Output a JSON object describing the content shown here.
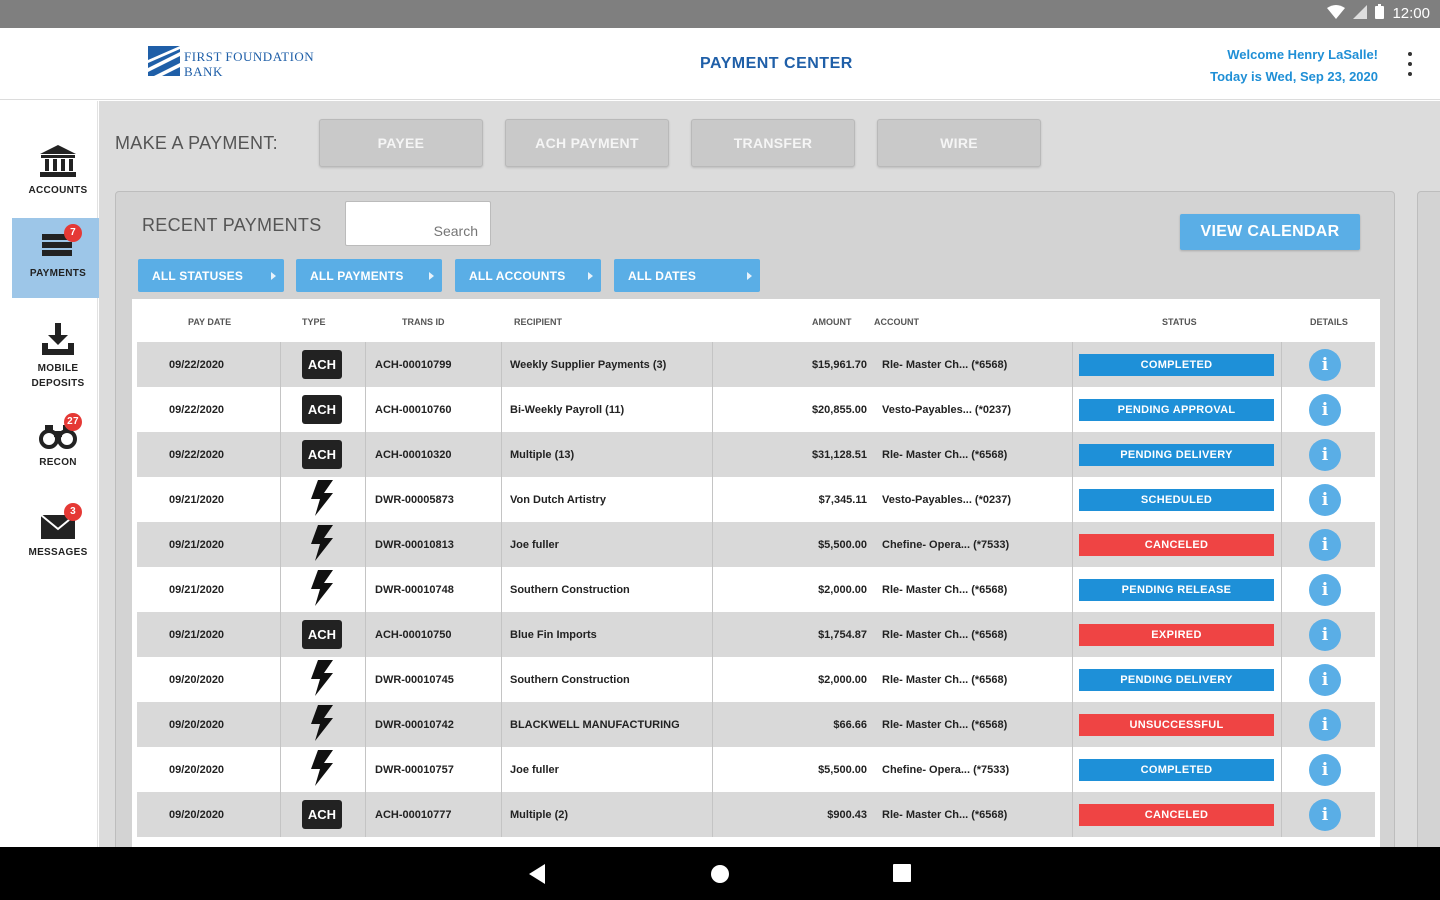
{
  "status_bar": {
    "time": "12:00"
  },
  "header": {
    "logo_line1": "FIRST FOUNDATION",
    "logo_line2": "BANK",
    "title": "PAYMENT CENTER",
    "welcome": "Welcome Henry LaSalle!",
    "date": "Today is Wed, Sep 23, 2020"
  },
  "sidebar": {
    "items": [
      {
        "label": "ACCOUNTS",
        "icon": "bank-icon",
        "badge": ""
      },
      {
        "label": "PAYMENTS",
        "icon": "payments-icon",
        "badge": "7"
      },
      {
        "label": "MOBILE\nDEPOSITS",
        "icon": "mobile-deposit-icon",
        "badge": ""
      },
      {
        "label": "RECON",
        "icon": "binoculars-icon",
        "badge": "27"
      },
      {
        "label": "MESSAGES",
        "icon": "envelope-icon",
        "badge": "3"
      }
    ]
  },
  "make_payment": {
    "label": "MAKE A PAYMENT:",
    "buttons": [
      "PAYEE",
      "ACH PAYMENT",
      "TRANSFER",
      "WIRE"
    ]
  },
  "recent": {
    "title": "RECENT PAYMENTS",
    "search_placeholder": "Search",
    "view_calendar": "VIEW CALENDAR",
    "filters": [
      "ALL STATUSES",
      "ALL PAYMENTS",
      "ALL ACCOUNTS",
      "ALL DATES"
    ],
    "columns": [
      "PAY DATE",
      "TYPE",
      "TRANS ID",
      "RECIPIENT",
      "AMOUNT",
      "ACCOUNT",
      "STATUS",
      "DETAILS"
    ],
    "rows": [
      {
        "date": "09/22/2020",
        "type": "ACH",
        "trans_id": "ACH-00010799",
        "recipient": "Weekly Supplier Payments (3)",
        "amount": "$15,961.70",
        "account": "Rle- Master Ch... (*6568)",
        "status": "COMPLETED",
        "status_color": "#1e90d8"
      },
      {
        "date": "09/22/2020",
        "type": "ACH",
        "trans_id": "ACH-00010760",
        "recipient": "Bi-Weekly Payroll (11)",
        "amount": "$20,855.00",
        "account": "Vesto-Payables... (*0237)",
        "status": "PENDING APPROVAL",
        "status_color": "#1e90d8"
      },
      {
        "date": "09/22/2020",
        "type": "ACH",
        "trans_id": "ACH-00010320",
        "recipient": "Multiple (13)",
        "amount": "$31,128.51",
        "account": "Rle- Master Ch... (*6568)",
        "status": "PENDING DELIVERY",
        "status_color": "#1e90d8"
      },
      {
        "date": "09/21/2020",
        "type": "WIRE",
        "trans_id": "DWR-00005873",
        "recipient": "Von Dutch Artistry",
        "amount": "$7,345.11",
        "account": "Vesto-Payables... (*0237)",
        "status": "SCHEDULED",
        "status_color": "#1e90d8"
      },
      {
        "date": "09/21/2020",
        "type": "WIRE",
        "trans_id": "DWR-00010813",
        "recipient": "Joe fuller",
        "amount": "$5,500.00",
        "account": "Chefine- Opera... (*7533)",
        "status": "CANCELED",
        "status_color": "#ef4444"
      },
      {
        "date": "09/21/2020",
        "type": "WIRE",
        "trans_id": "DWR-00010748",
        "recipient": "Southern Construction",
        "amount": "$2,000.00",
        "account": "Rle- Master Ch... (*6568)",
        "status": "PENDING RELEASE",
        "status_color": "#1e90d8"
      },
      {
        "date": "09/21/2020",
        "type": "ACH",
        "trans_id": "ACH-00010750",
        "recipient": "Blue Fin Imports",
        "amount": "$1,754.87",
        "account": "Rle- Master Ch... (*6568)",
        "status": "EXPIRED",
        "status_color": "#ef4444"
      },
      {
        "date": "09/20/2020",
        "type": "WIRE",
        "trans_id": "DWR-00010745",
        "recipient": "Southern Construction",
        "amount": "$2,000.00",
        "account": "Rle- Master Ch... (*6568)",
        "status": "PENDING DELIVERY",
        "status_color": "#1e90d8"
      },
      {
        "date": "09/20/2020",
        "type": "WIRE",
        "trans_id": "DWR-00010742",
        "recipient": "BLACKWELL MANUFACTURING",
        "amount": "$66.66",
        "account": "Rle- Master Ch... (*6568)",
        "status": "UNSUCCESSFUL",
        "status_color": "#ef4444"
      },
      {
        "date": "09/20/2020",
        "type": "WIRE",
        "trans_id": "DWR-00010757",
        "recipient": "Joe fuller",
        "amount": "$5,500.00",
        "account": "Chefine- Opera... (*7533)",
        "status": "COMPLETED",
        "status_color": "#1e90d8"
      },
      {
        "date": "09/20/2020",
        "type": "ACH",
        "trans_id": "ACH-00010777",
        "recipient": "Multiple (2)",
        "amount": "$900.43",
        "account": "Rle- Master Ch... (*6568)",
        "status": "CANCELED",
        "status_color": "#ef4444"
      }
    ]
  },
  "colors": {
    "accent": "#5aaee6",
    "brand": "#1f5fa8",
    "danger": "#ef4444"
  }
}
